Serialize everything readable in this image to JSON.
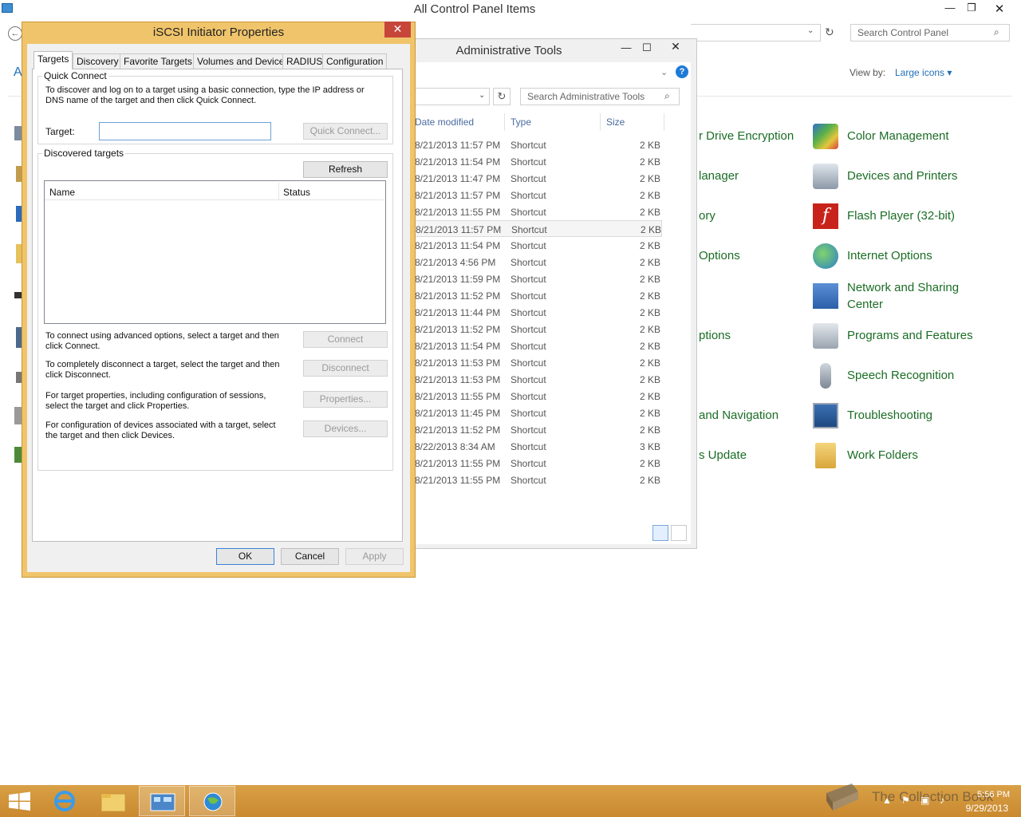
{
  "control_panel": {
    "title": "All Control Panel Items",
    "search_placeholder": "Search Control Panel",
    "view_by_label": "View by:",
    "view_by_value": "Large icons ▾",
    "left_letter": "A",
    "items_right": [
      "Color Management",
      "Devices and Printers",
      "Flash Player (32-bit)",
      "Internet Options",
      "Network and Sharing Center",
      "Programs and Features",
      "Speech Recognition",
      "Troubleshooting",
      "Work Folders"
    ],
    "items_partial": [
      "r Drive Encryption",
      "lanager",
      "ory",
      "Options",
      "ptions",
      "and Navigation",
      "s Update"
    ]
  },
  "admin_tools": {
    "title": "Administrative Tools",
    "search_placeholder": "Search Administrative Tools",
    "columns": [
      "Date modified",
      "Type",
      "Size"
    ],
    "rows": [
      {
        "date": "8/21/2013 11:57 PM",
        "type": "Shortcut",
        "size": "2 KB"
      },
      {
        "date": "8/21/2013 11:54 PM",
        "type": "Shortcut",
        "size": "2 KB"
      },
      {
        "date": "8/21/2013 11:47 PM",
        "type": "Shortcut",
        "size": "2 KB"
      },
      {
        "date": "8/21/2013 11:57 PM",
        "type": "Shortcut",
        "size": "2 KB"
      },
      {
        "date": "8/21/2013 11:55 PM",
        "type": "Shortcut",
        "size": "2 KB"
      },
      {
        "date": "8/21/2013 11:57 PM",
        "type": "Shortcut",
        "size": "2 KB"
      },
      {
        "date": "8/21/2013 11:54 PM",
        "type": "Shortcut",
        "size": "2 KB"
      },
      {
        "date": "8/21/2013 4:56 PM",
        "type": "Shortcut",
        "size": "2 KB"
      },
      {
        "date": "8/21/2013 11:59 PM",
        "type": "Shortcut",
        "size": "2 KB"
      },
      {
        "date": "8/21/2013 11:52 PM",
        "type": "Shortcut",
        "size": "2 KB"
      },
      {
        "date": "8/21/2013 11:44 PM",
        "type": "Shortcut",
        "size": "2 KB"
      },
      {
        "date": "8/21/2013 11:52 PM",
        "type": "Shortcut",
        "size": "2 KB"
      },
      {
        "date": "8/21/2013 11:54 PM",
        "type": "Shortcut",
        "size": "2 KB"
      },
      {
        "date": "8/21/2013 11:53 PM",
        "type": "Shortcut",
        "size": "2 KB"
      },
      {
        "date": "8/21/2013 11:53 PM",
        "type": "Shortcut",
        "size": "2 KB"
      },
      {
        "date": "8/21/2013 11:55 PM",
        "type": "Shortcut",
        "size": "2 KB"
      },
      {
        "date": "8/21/2013 11:45 PM",
        "type": "Shortcut",
        "size": "2 KB"
      },
      {
        "date": "8/21/2013 11:52 PM",
        "type": "Shortcut",
        "size": "2 KB"
      },
      {
        "date": "8/22/2013 8:34 AM",
        "type": "Shortcut",
        "size": "3 KB"
      },
      {
        "date": "8/21/2013 11:55 PM",
        "type": "Shortcut",
        "size": "2 KB"
      },
      {
        "date": "8/21/2013 11:55 PM",
        "type": "Shortcut",
        "size": "2 KB"
      }
    ]
  },
  "dialog": {
    "title": "iSCSI Initiator Properties",
    "close": "✕",
    "tabs": [
      "Targets",
      "Discovery",
      "Favorite Targets",
      "Volumes and Devices",
      "RADIUS",
      "Configuration"
    ],
    "quick_connect": {
      "legend": "Quick Connect",
      "description": "To discover and log on to a target using a basic connection, type the IP address or DNS name of the target and then click Quick Connect.",
      "target_label": "Target:",
      "target_value": "",
      "button": "Quick Connect..."
    },
    "discovered": {
      "legend": "Discovered targets",
      "refresh": "Refresh",
      "columns": [
        "Name",
        "Status"
      ]
    },
    "actions": [
      {
        "text": "To connect using advanced options, select a target and then click Connect.",
        "button": "Connect"
      },
      {
        "text": "To completely disconnect a target, select the target and then click Disconnect.",
        "button": "Disconnect"
      },
      {
        "text": "For target properties, including configuration of sessions, select the target and click Properties.",
        "button": "Properties..."
      },
      {
        "text": "For configuration of devices associated with a target, select the target and then click Devices.",
        "button": "Devices..."
      }
    ],
    "ok": "OK",
    "cancel": "Cancel",
    "apply": "Apply"
  },
  "taskbar": {
    "time": "5:56 PM",
    "date": "9/29/2013",
    "watermark": "The Collection Book"
  },
  "colors": {
    "dialog_frame": "#f0c46b",
    "taskbar": "#d29638",
    "cp_link": "#1b6d25",
    "close_red": "#c7463a"
  }
}
